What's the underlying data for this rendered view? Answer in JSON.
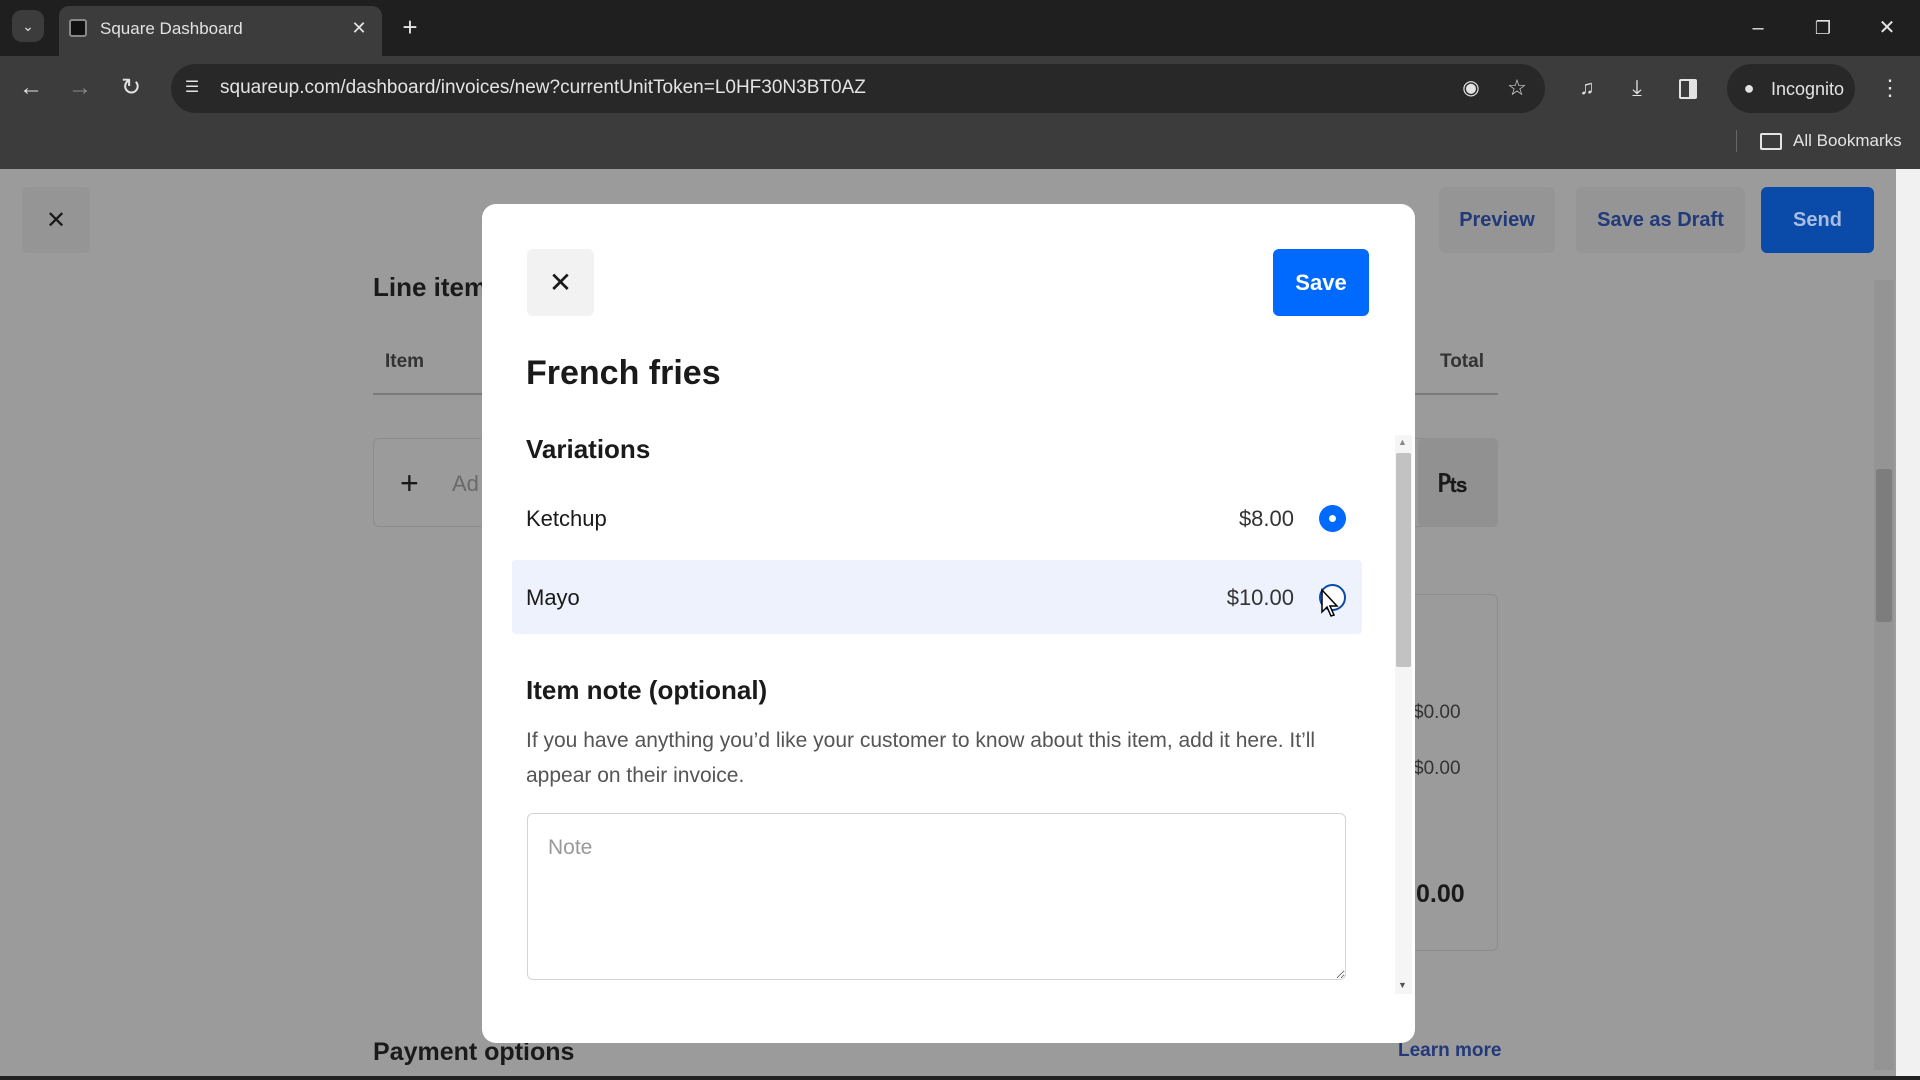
{
  "browser": {
    "tab_title": "Square Dashboard",
    "url": "squareup.com/dashboard/invoices/new?currentUnitToken=L0HF30N3BT0AZ",
    "incognito_label": "Incognito",
    "bookmarks_label": "All Bookmarks"
  },
  "page": {
    "actions": {
      "preview": "Preview",
      "save_draft": "Save as Draft",
      "send": "Send"
    },
    "line_items_heading": "Line item",
    "columns": {
      "item": "Item",
      "total": "Total"
    },
    "add_item_partial": "Ad",
    "summary_values": [
      "$0.00",
      "$0.00",
      "0.00"
    ],
    "payment_options_heading": "Payment options",
    "learn_more": "Learn more"
  },
  "modal": {
    "save_label": "Save",
    "title": "French fries",
    "variations_heading": "Variations",
    "variations": [
      {
        "name": "Ketchup",
        "price": "$8.00",
        "selected": true
      },
      {
        "name": "Mayo",
        "price": "$10.00",
        "selected": false
      }
    ],
    "note_heading": "Item note (optional)",
    "note_description": "If you have anything you’d like your customer to know about this item, add it here. It’ll appear on their invoice.",
    "note_placeholder": "Note",
    "note_value": ""
  },
  "colors": {
    "accent": "#006aff",
    "send_dimmed": "#0a4aa8",
    "highlight_row": "#eef2fd"
  }
}
